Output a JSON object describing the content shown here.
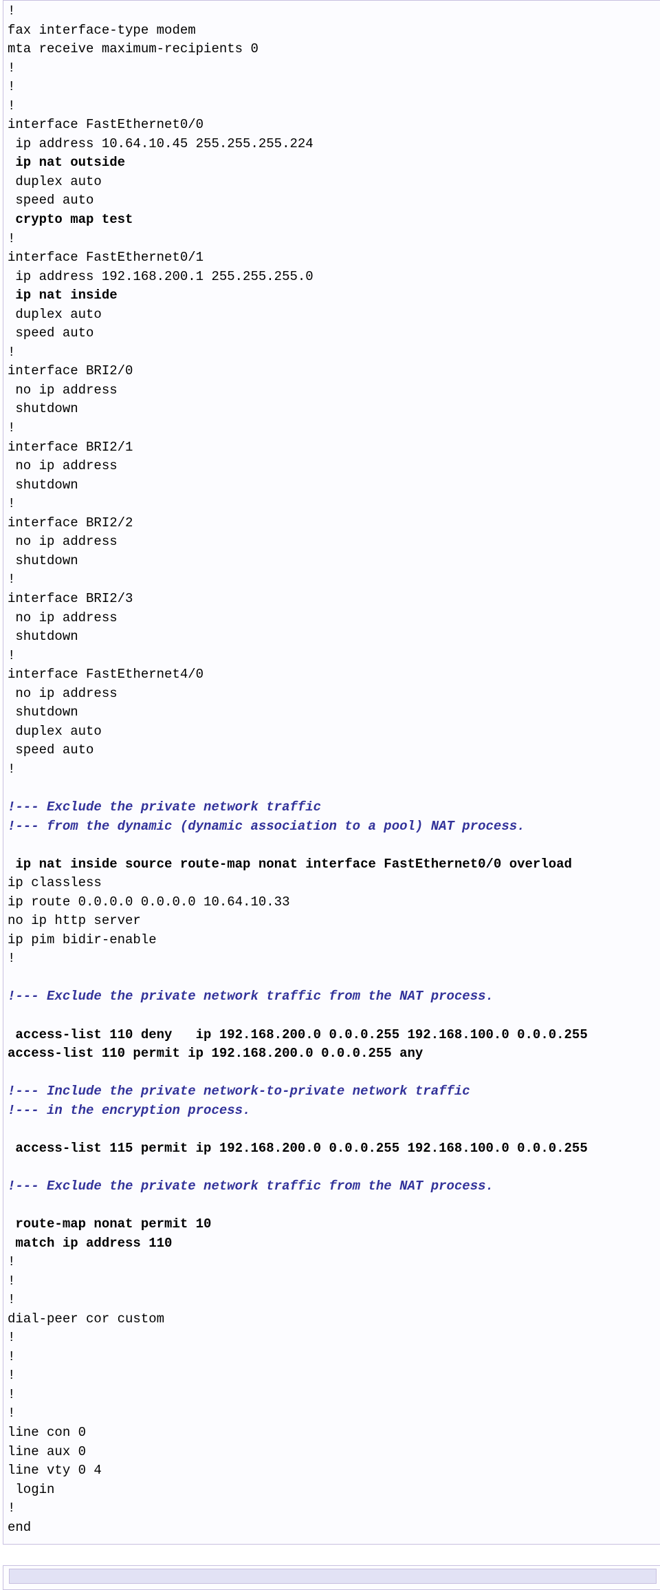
{
  "config": {
    "lines": [
      {
        "t": "!"
      },
      {
        "t": "fax interface-type modem"
      },
      {
        "t": "mta receive maximum-recipients 0"
      },
      {
        "t": "!"
      },
      {
        "t": "!"
      },
      {
        "t": "!"
      },
      {
        "t": "interface FastEthernet0/0"
      },
      {
        "t": " ip address 10.64.10.45 255.255.255.224"
      },
      {
        "t": " ip nat outside",
        "b": true
      },
      {
        "t": " duplex auto"
      },
      {
        "t": " speed auto"
      },
      {
        "t": " crypto map test",
        "b": true
      },
      {
        "t": "!"
      },
      {
        "t": "interface FastEthernet0/1"
      },
      {
        "t": " ip address 192.168.200.1 255.255.255.0"
      },
      {
        "t": " ip nat inside",
        "b": true
      },
      {
        "t": " duplex auto"
      },
      {
        "t": " speed auto"
      },
      {
        "t": "!"
      },
      {
        "t": "interface BRI2/0"
      },
      {
        "t": " no ip address"
      },
      {
        "t": " shutdown"
      },
      {
        "t": "!"
      },
      {
        "t": "interface BRI2/1"
      },
      {
        "t": " no ip address"
      },
      {
        "t": " shutdown"
      },
      {
        "t": "!"
      },
      {
        "t": "interface BRI2/2"
      },
      {
        "t": " no ip address"
      },
      {
        "t": " shutdown"
      },
      {
        "t": "!"
      },
      {
        "t": "interface BRI2/3"
      },
      {
        "t": " no ip address"
      },
      {
        "t": " shutdown"
      },
      {
        "t": "!"
      },
      {
        "t": "interface FastEthernet4/0"
      },
      {
        "t": " no ip address"
      },
      {
        "t": " shutdown"
      },
      {
        "t": " duplex auto"
      },
      {
        "t": " speed auto"
      },
      {
        "t": "!"
      },
      {
        "t": ""
      },
      {
        "t": "!--- Exclude the private network traffic",
        "c": true
      },
      {
        "t": "!--- from the dynamic (dynamic association to a pool) NAT process.",
        "c": true
      },
      {
        "t": ""
      },
      {
        "t": " ip nat inside source route-map nonat interface FastEthernet0/0 overload",
        "b": true
      },
      {
        "t": "ip classless"
      },
      {
        "t": "ip route 0.0.0.0 0.0.0.0 10.64.10.33"
      },
      {
        "t": "no ip http server"
      },
      {
        "t": "ip pim bidir-enable"
      },
      {
        "t": "!"
      },
      {
        "t": ""
      },
      {
        "t": "!--- Exclude the private network traffic from the NAT process.",
        "c": true
      },
      {
        "t": ""
      },
      {
        "t": " access-list 110 deny   ip 192.168.200.0 0.0.0.255 192.168.100.0 0.0.0.255",
        "b": true
      },
      {
        "t": "access-list 110 permit ip 192.168.200.0 0.0.0.255 any",
        "b": true
      },
      {
        "t": ""
      },
      {
        "t": "!--- Include the private network-to-private network traffic",
        "c": true
      },
      {
        "t": "!--- in the encryption process.",
        "c": true
      },
      {
        "t": ""
      },
      {
        "t": " access-list 115 permit ip 192.168.200.0 0.0.0.255 192.168.100.0 0.0.0.255",
        "b": true
      },
      {
        "t": ""
      },
      {
        "t": "!--- Exclude the private network traffic from the NAT process.",
        "c": true
      },
      {
        "t": ""
      },
      {
        "t": " route-map nonat permit 10",
        "b": true
      },
      {
        "t": " match ip address 110",
        "b": true
      },
      {
        "t": "!"
      },
      {
        "t": "!"
      },
      {
        "t": "!"
      },
      {
        "t": "dial-peer cor custom"
      },
      {
        "t": "!"
      },
      {
        "t": "!"
      },
      {
        "t": "!"
      },
      {
        "t": "!"
      },
      {
        "t": "!"
      },
      {
        "t": "line con 0"
      },
      {
        "t": "line aux 0"
      },
      {
        "t": "line vty 0 4"
      },
      {
        "t": " login"
      },
      {
        "t": "!"
      },
      {
        "t": "end"
      }
    ]
  }
}
